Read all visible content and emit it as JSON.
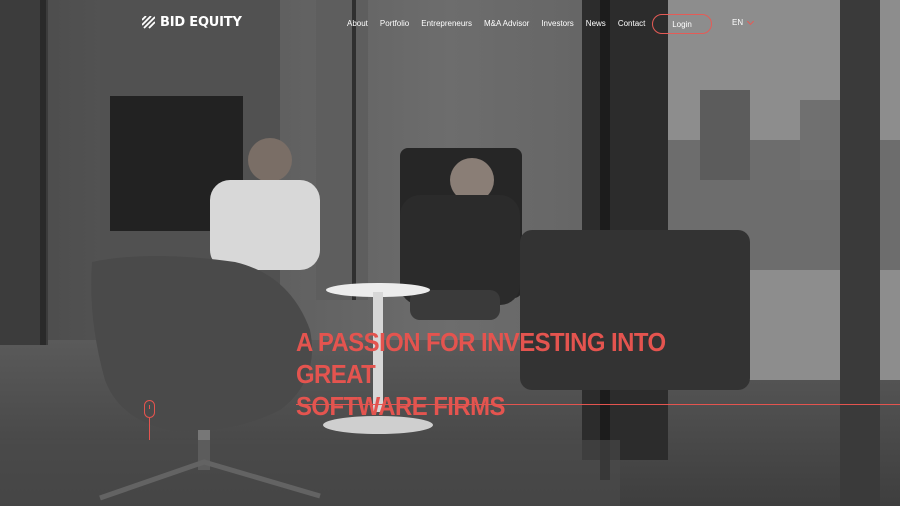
{
  "brand": {
    "name": "BID EQUITY"
  },
  "nav": {
    "items": [
      {
        "label": "About"
      },
      {
        "label": "Portfolio"
      },
      {
        "label": "Entrepreneurs"
      },
      {
        "label": "M&A Advisor"
      },
      {
        "label": "Investors"
      },
      {
        "label": "News"
      },
      {
        "label": "Contact"
      }
    ],
    "login_label": "Login",
    "language": "EN"
  },
  "hero": {
    "headline_line1": "A PASSION FOR INVESTING INTO GREAT",
    "headline_line2": "SOFTWARE FIRMS"
  },
  "colors": {
    "accent": "#e4544f",
    "text": "#ffffff",
    "photo_tone": "grayscale"
  },
  "icons": {
    "logo": "stripes-logo-icon",
    "scroll": "mouse-scroll-icon",
    "language": "chevron-down-icon"
  }
}
